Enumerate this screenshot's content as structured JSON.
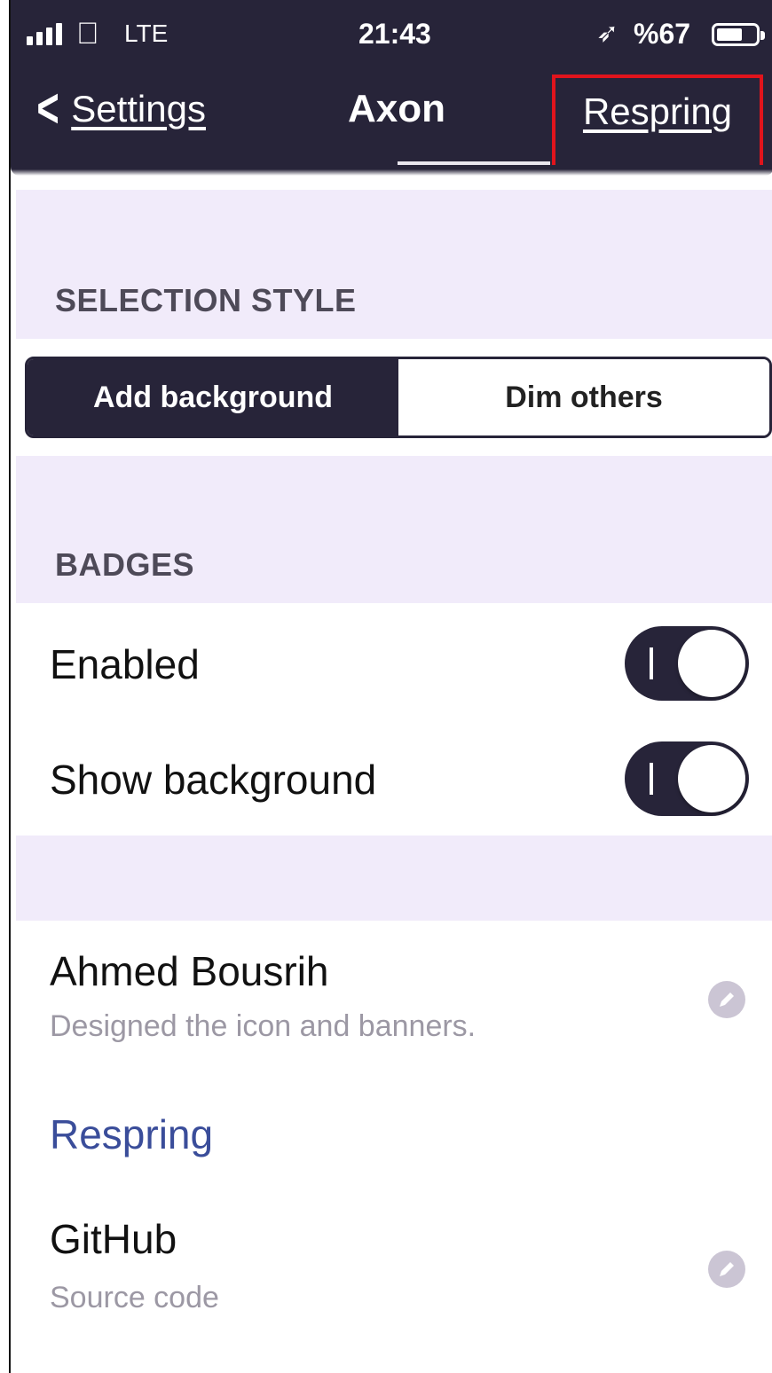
{
  "status_bar": {
    "carrier_icon": "apple-icon",
    "network": "LTE",
    "time": "21:43",
    "location_icon": "location-arrow-icon",
    "battery_percent": "%67",
    "battery_level": 0.67
  },
  "nav": {
    "back_label": "Settings",
    "title": "Axon",
    "right_button": "Respring",
    "highlight_color": "#e0141c"
  },
  "selection_style": {
    "header": "SELECTION STYLE",
    "options": [
      "Add background",
      "Dim others"
    ],
    "selected_index": 0
  },
  "badges": {
    "header": "BADGES",
    "rows": [
      {
        "label": "Enabled",
        "on": true
      },
      {
        "label": "Show background",
        "on": true
      }
    ]
  },
  "credits": {
    "name": "Ahmed Bousrih",
    "description": "Designed the icon and banners."
  },
  "links": {
    "respring": "Respring",
    "github_title": "GitHub",
    "github_sub": "Source code"
  },
  "colors": {
    "nav_bg": "#272439",
    "section_bg": "#f1ebfa",
    "link": "#3a4d9a"
  }
}
